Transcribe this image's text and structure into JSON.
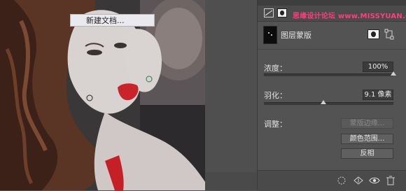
{
  "canvas": {
    "tooltip_text": "新建文档..."
  },
  "panel": {
    "watermark_text": "思缘设计论坛 www.MISSYUAN.COM",
    "layer_mask_label": "图层蒙版",
    "density": {
      "label": "浓度：",
      "value": "100%",
      "level": 1.0
    },
    "feather": {
      "label": "羽化：",
      "value": "9.1 像素",
      "level": 0.46
    },
    "refine_label": "调整：",
    "buttons": {
      "mask_edge": "蒙版边缘...",
      "color_range": "颜色范围...",
      "invert": "反相"
    }
  },
  "icons": {
    "adjustment": "adjustment-layer-icon",
    "add_pixel_mask": "add-pixel-mask-icon",
    "add_vector_mask": "add-vector-mask-icon",
    "selection_from_mask": "load-selection-icon",
    "apply_mask": "apply-mask-icon",
    "visibility": "eye-icon",
    "delete": "trash-icon"
  },
  "colors": {
    "panel_bg": "#535353",
    "watermark": "#ff3d7f",
    "lips": "#c8242a"
  }
}
